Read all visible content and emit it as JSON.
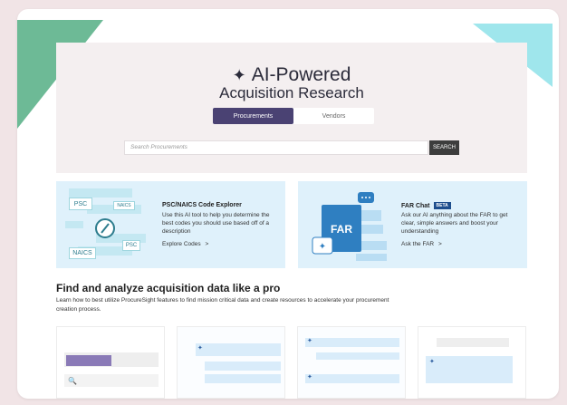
{
  "hero": {
    "title": "AI-Powered",
    "subtitle": "Acquisition Research",
    "tabs": [
      {
        "label": "Procurements",
        "active": true
      },
      {
        "label": "Vendors",
        "active": false
      }
    ],
    "search": {
      "placeholder": "Search Procurements",
      "button_label": "SEARCH"
    }
  },
  "cards": {
    "code_explorer": {
      "title": "PSC/NAICS Code Explorer",
      "description": "Use this AI tool to help you determine the best codes you should use based off of a description",
      "link": "Explore Codes",
      "link_arrow": ">",
      "tags": {
        "psc": "PSC",
        "naics_small": "NAICS",
        "naics_large": "NAICS",
        "psc_small": "PSC"
      }
    },
    "far_chat": {
      "title": "FAR Chat",
      "badge": "BETA",
      "description": "Ask our AI anything about the FAR to get clear, simple answers and boost your understanding",
      "link": "Ask the FAR",
      "link_arrow": ">",
      "doc_label": "FAR"
    }
  },
  "section": {
    "title": "Find and analyze acquisition data like a pro",
    "description": "Learn how to best utilize ProcureSight features to find mission critical data and create resources to accelerate your procurement creation process."
  },
  "colors": {
    "accent_purple": "#4a4273",
    "card_bg": "#dff1fb",
    "hero_bg": "#f4eff0",
    "deco_green": "#6dba96",
    "deco_cyan": "#9fe6ec"
  },
  "icons": [
    "sparkle-icon",
    "compass-icon",
    "chat-bubble-icon",
    "search-icon"
  ]
}
